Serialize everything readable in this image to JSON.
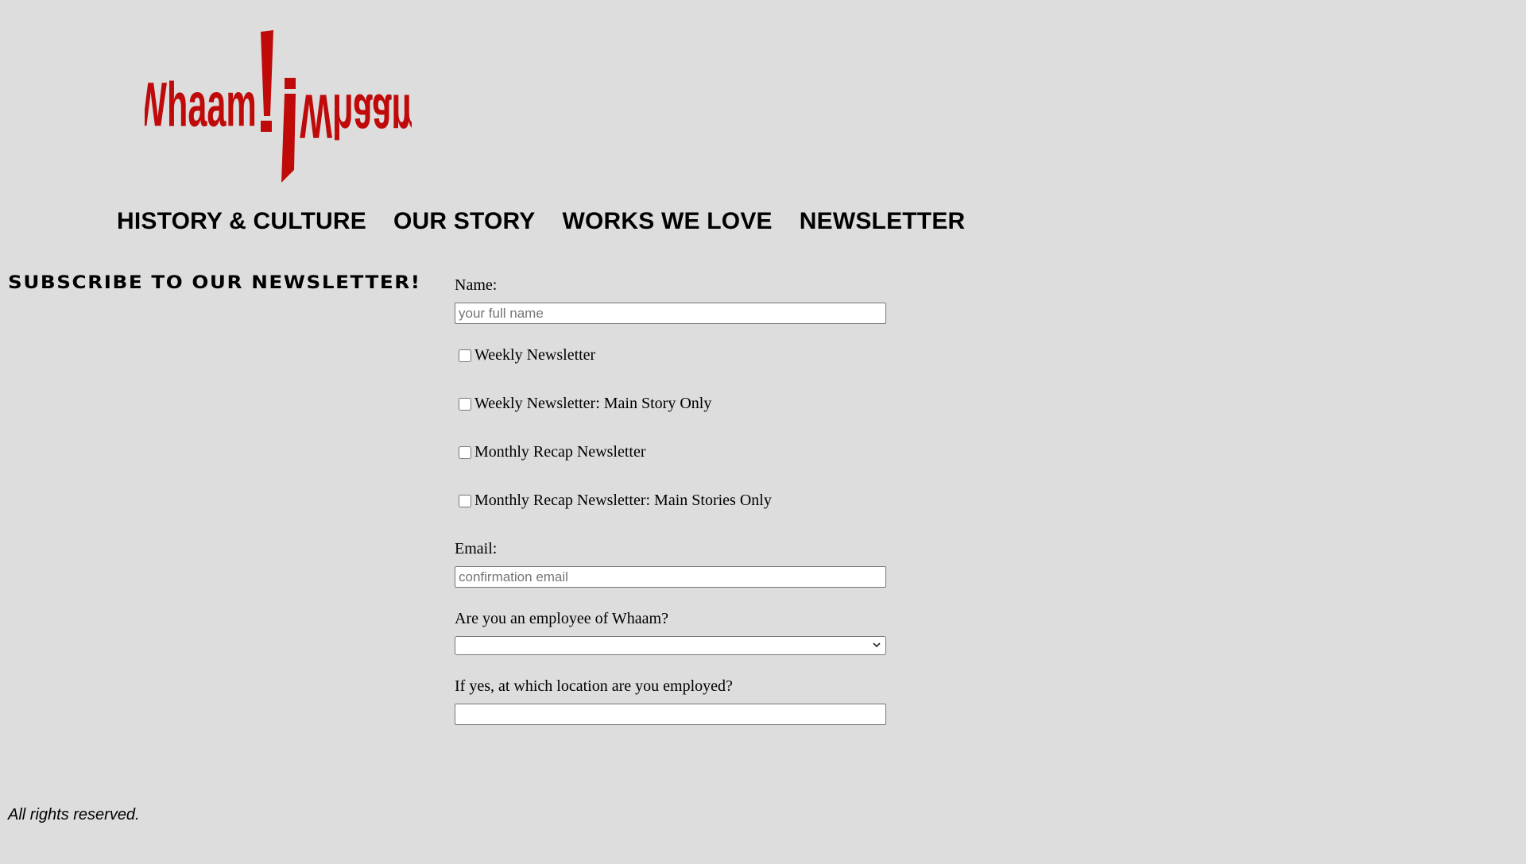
{
  "brand": {
    "logo_text": "Whaam!",
    "accent_color": "#c00a0a"
  },
  "nav": {
    "items": [
      {
        "label": "HISTORY & CULTURE"
      },
      {
        "label": "OUR STORY"
      },
      {
        "label": "WORKS WE LOVE"
      },
      {
        "label": "NEWSLETTER"
      }
    ]
  },
  "newsletter": {
    "heading": "SUBSCRIBE TO OUR NEWSLETTER!",
    "name_label": "Name:",
    "name_placeholder": "your full name",
    "name_value": "",
    "options": [
      {
        "label": "Weekly Newsletter",
        "checked": false
      },
      {
        "label": "Weekly Newsletter: Main Story Only",
        "checked": false
      },
      {
        "label": "Monthly Recap Newsletter",
        "checked": false
      },
      {
        "label": "Monthly Recap Newsletter: Main Stories Only",
        "checked": false
      }
    ],
    "email_label": "Email:",
    "email_placeholder": "confirmation email",
    "email_value": "",
    "employee_label": "Are you an employee of Whaam?",
    "employee_selected": "",
    "location_label": "If yes, at which location are you employed?",
    "location_value": ""
  },
  "icons": {
    "select_arrow": "chevron-down-icon"
  },
  "footer": {
    "text": "All rights reserved."
  }
}
